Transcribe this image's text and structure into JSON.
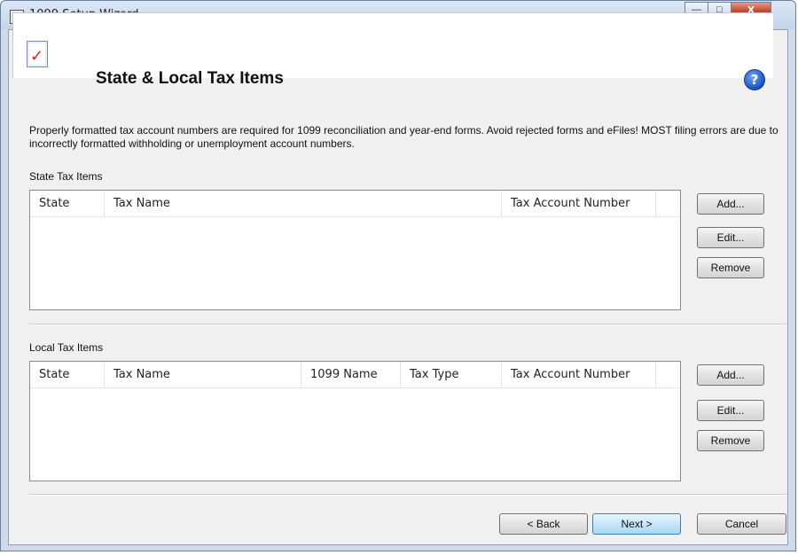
{
  "window": {
    "title": "1099 Setup Wizard",
    "app_icon": "T",
    "controls": {
      "minimize": "—",
      "maximize": "□",
      "close": "X"
    }
  },
  "header": {
    "title": "State & Local Tax Items",
    "help": "?"
  },
  "description": "Properly formatted tax account numbers are required for 1099 reconciliation and year-end forms. Avoid rejected forms and eFiles! MOST filing errors are due to incorrectly formatted withholding or unemployment account numbers.",
  "state_section": {
    "label": "State Tax Items",
    "columns": [
      "State",
      "Tax Name",
      "Tax Account Number"
    ],
    "rows": [],
    "buttons": {
      "add": "Add...",
      "edit": "Edit...",
      "remove": "Remove"
    }
  },
  "local_section": {
    "label": "Local Tax Items",
    "columns": [
      "State",
      "Tax Name",
      "1099 Name",
      "Tax Type",
      "Tax Account Number"
    ],
    "rows": [],
    "buttons": {
      "add": "Add...",
      "edit": "Edit...",
      "remove": "Remove"
    }
  },
  "footer": {
    "back": "< Back",
    "next": "Next >",
    "cancel": "Cancel"
  },
  "colors": {
    "window_frame": "#cfdbea",
    "client_bg": "#f0f0f0",
    "primary_button": "#c7e6f9",
    "close_button": "#c8432a",
    "help_icon": "#1d4fbf"
  }
}
